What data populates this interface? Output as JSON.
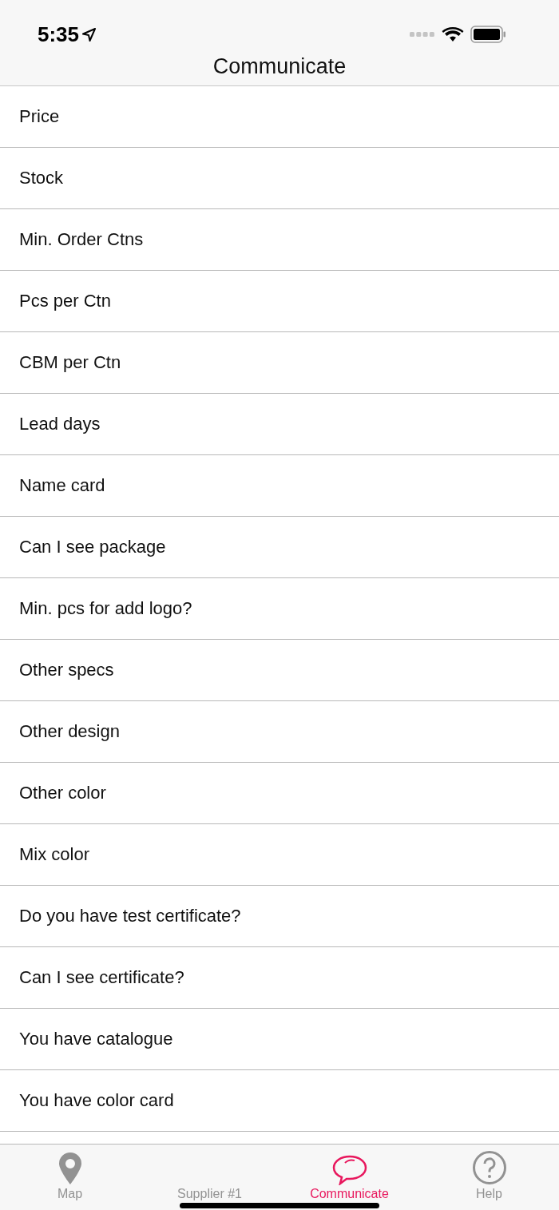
{
  "status_bar": {
    "time": "5:35"
  },
  "nav": {
    "title": "Communicate"
  },
  "items": [
    {
      "label": "Price"
    },
    {
      "label": "Stock"
    },
    {
      "label": "Min. Order Ctns"
    },
    {
      "label": "Pcs per Ctn"
    },
    {
      "label": "CBM per Ctn"
    },
    {
      "label": "Lead days"
    },
    {
      "label": "Name card"
    },
    {
      "label": "Can I see package"
    },
    {
      "label": "Min. pcs for add logo?"
    },
    {
      "label": "Other specs"
    },
    {
      "label": "Other design"
    },
    {
      "label": "Other color"
    },
    {
      "label": "Mix color"
    },
    {
      "label": "Do you have test certificate?"
    },
    {
      "label": "Can I see certificate?"
    },
    {
      "label": "You have catalogue"
    },
    {
      "label": "You have color card"
    }
  ],
  "tabs": [
    {
      "label": "Map",
      "kind": "pin",
      "selected": false
    },
    {
      "label": "Supplier #1",
      "kind": "none",
      "selected": false
    },
    {
      "label": "Communicate",
      "kind": "chat",
      "selected": true
    },
    {
      "label": "Help",
      "kind": "help",
      "selected": false
    }
  ]
}
